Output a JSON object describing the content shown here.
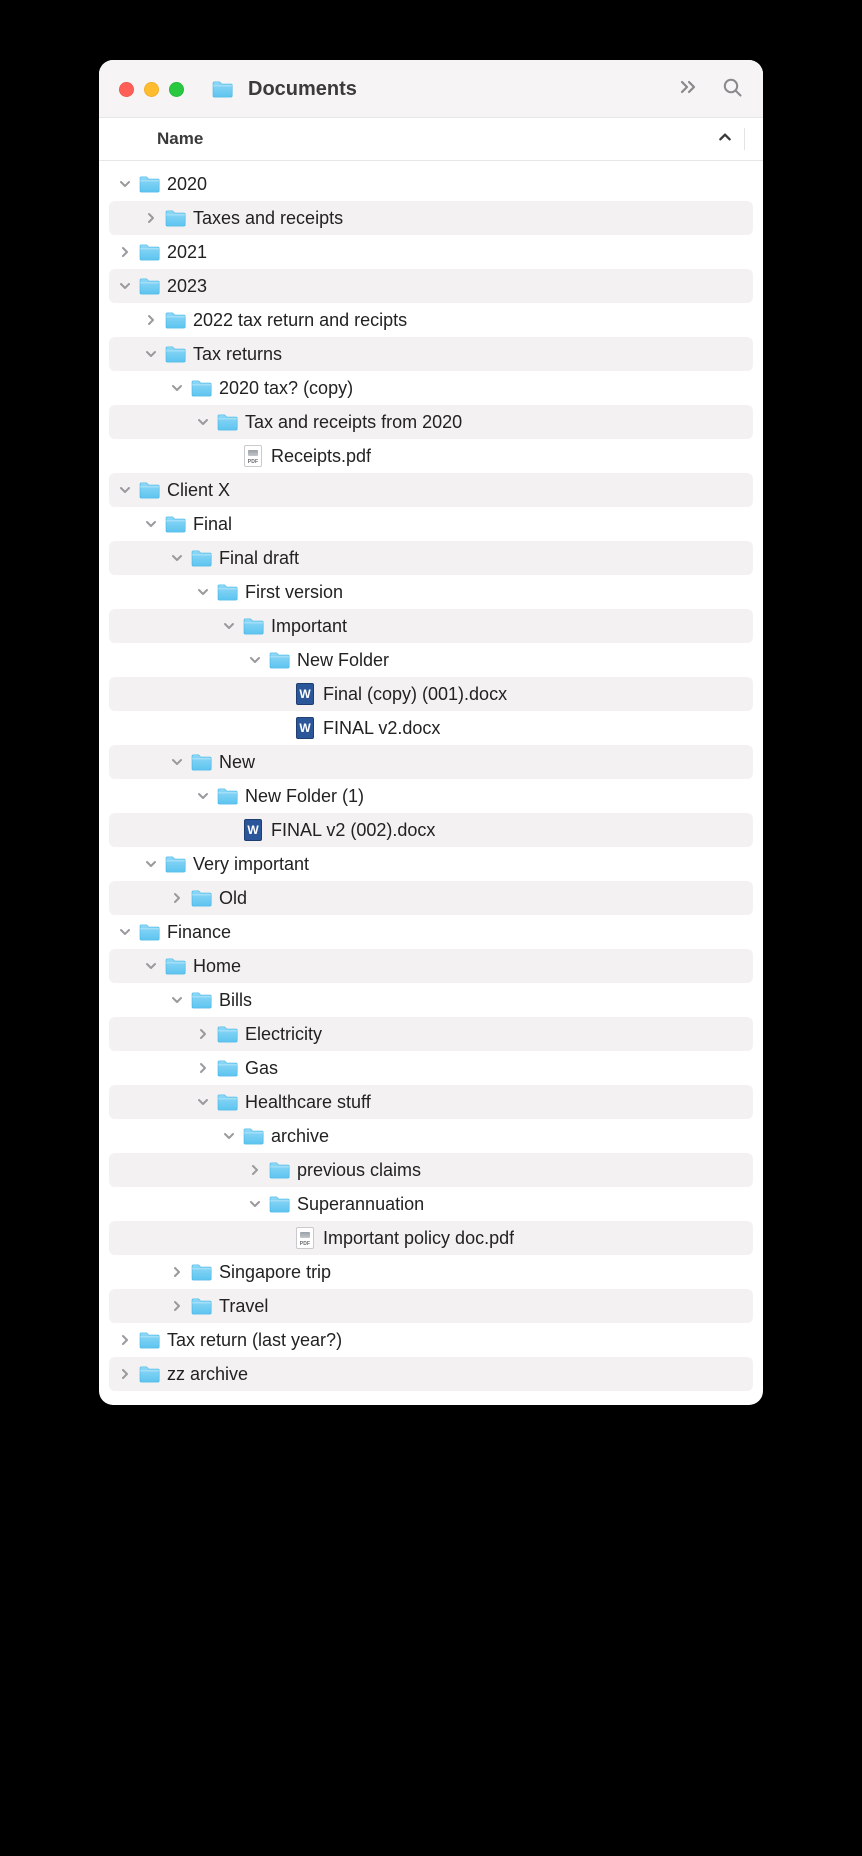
{
  "window": {
    "title": "Documents"
  },
  "columns": {
    "name": "Name"
  },
  "tree": [
    {
      "depth": 0,
      "state": "open",
      "type": "folder",
      "label": "2020"
    },
    {
      "depth": 1,
      "state": "closed",
      "type": "folder",
      "label": "Taxes and receipts"
    },
    {
      "depth": 0,
      "state": "closed",
      "type": "folder",
      "label": "2021"
    },
    {
      "depth": 0,
      "state": "open",
      "type": "folder",
      "label": "2023"
    },
    {
      "depth": 1,
      "state": "closed",
      "type": "folder",
      "label": "2022 tax return and recipts"
    },
    {
      "depth": 1,
      "state": "open",
      "type": "folder",
      "label": "Tax returns"
    },
    {
      "depth": 2,
      "state": "open",
      "type": "folder",
      "label": "2020 tax? (copy)"
    },
    {
      "depth": 3,
      "state": "open",
      "type": "folder",
      "label": "Tax and receipts from 2020"
    },
    {
      "depth": 4,
      "state": "none",
      "type": "pdf",
      "label": "Receipts.pdf"
    },
    {
      "depth": 0,
      "state": "open",
      "type": "folder",
      "label": "Client X"
    },
    {
      "depth": 1,
      "state": "open",
      "type": "folder",
      "label": "Final"
    },
    {
      "depth": 2,
      "state": "open",
      "type": "folder",
      "label": "Final draft"
    },
    {
      "depth": 3,
      "state": "open",
      "type": "folder",
      "label": "First version"
    },
    {
      "depth": 4,
      "state": "open",
      "type": "folder",
      "label": "Important"
    },
    {
      "depth": 5,
      "state": "open",
      "type": "folder",
      "label": "New Folder"
    },
    {
      "depth": 6,
      "state": "none",
      "type": "docx",
      "label": "Final (copy) (001).docx"
    },
    {
      "depth": 6,
      "state": "none",
      "type": "docx",
      "label": "FINAL v2.docx"
    },
    {
      "depth": 2,
      "state": "open",
      "type": "folder",
      "label": "New"
    },
    {
      "depth": 3,
      "state": "open",
      "type": "folder",
      "label": "New Folder (1)"
    },
    {
      "depth": 4,
      "state": "none",
      "type": "docx",
      "label": "FINAL v2 (002).docx"
    },
    {
      "depth": 1,
      "state": "open",
      "type": "folder",
      "label": "Very important"
    },
    {
      "depth": 2,
      "state": "closed",
      "type": "folder",
      "label": "Old"
    },
    {
      "depth": 0,
      "state": "open",
      "type": "folder",
      "label": "Finance"
    },
    {
      "depth": 1,
      "state": "open",
      "type": "folder",
      "label": "Home"
    },
    {
      "depth": 2,
      "state": "open",
      "type": "folder",
      "label": "Bills"
    },
    {
      "depth": 3,
      "state": "closed",
      "type": "folder",
      "label": "Electricity"
    },
    {
      "depth": 3,
      "state": "closed",
      "type": "folder",
      "label": "Gas"
    },
    {
      "depth": 3,
      "state": "open",
      "type": "folder",
      "label": "Healthcare stuff"
    },
    {
      "depth": 4,
      "state": "open",
      "type": "folder",
      "label": "archive"
    },
    {
      "depth": 5,
      "state": "closed",
      "type": "folder",
      "label": "previous claims"
    },
    {
      "depth": 5,
      "state": "open",
      "type": "folder",
      "label": "Superannuation"
    },
    {
      "depth": 6,
      "state": "none",
      "type": "pdf",
      "label": "Important policy doc.pdf"
    },
    {
      "depth": 2,
      "state": "closed",
      "type": "folder",
      "label": "Singapore trip"
    },
    {
      "depth": 2,
      "state": "closed",
      "type": "folder",
      "label": "Travel"
    },
    {
      "depth": 0,
      "state": "closed",
      "type": "folder",
      "label": "Tax return (last year?)"
    },
    {
      "depth": 0,
      "state": "closed",
      "type": "folder",
      "label": "zz archive"
    }
  ]
}
